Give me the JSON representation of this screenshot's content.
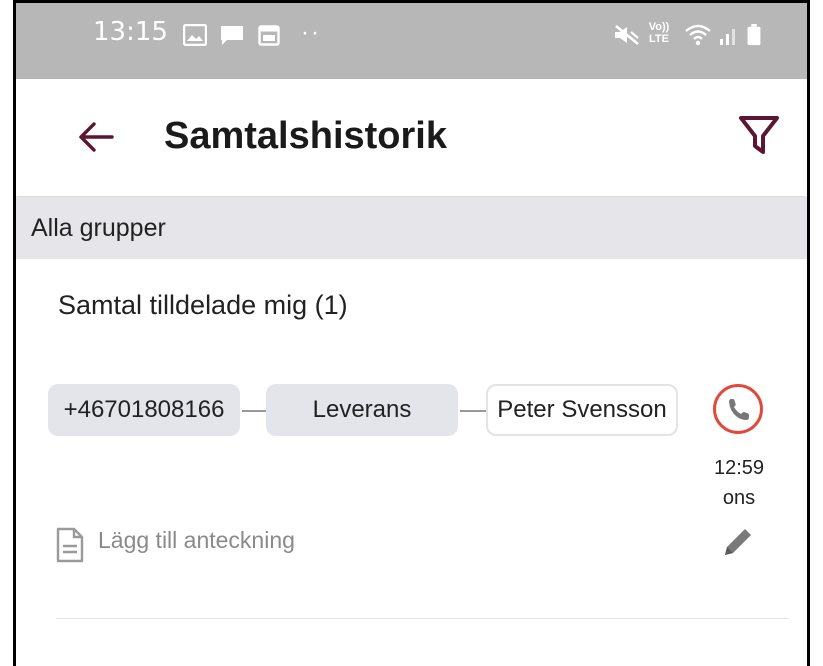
{
  "status_bar": {
    "time": "13:15",
    "left_icons": [
      "image-icon",
      "chat-icon",
      "calendar-icon",
      "more-dots-icon"
    ],
    "right_icons": [
      "mute-icon",
      "volte-icon",
      "wifi-icon",
      "signal-icon",
      "battery-icon"
    ],
    "volte_top": "Vo))",
    "volte_bottom": "LTE",
    "dots": "··"
  },
  "app_bar": {
    "title": "Samtalshistorik",
    "back_icon": "back-arrow-icon",
    "filter_icon": "filter-icon",
    "accent_color": "#5a1632"
  },
  "group_bar": {
    "label": "Alla grupper"
  },
  "section": {
    "title": "Samtal tilldelade mig  (1)"
  },
  "call": {
    "phone_number": "+46701808166",
    "group": "Leverans",
    "agent": "Peter Svensson",
    "time": "12:59",
    "day": "ons",
    "call_icon": "phone-icon",
    "call_icon_ring_color": "#e04a3d",
    "note_placeholder": "Lägg till anteckning",
    "note_icon": "note-icon",
    "edit_icon": "pencil-icon"
  }
}
